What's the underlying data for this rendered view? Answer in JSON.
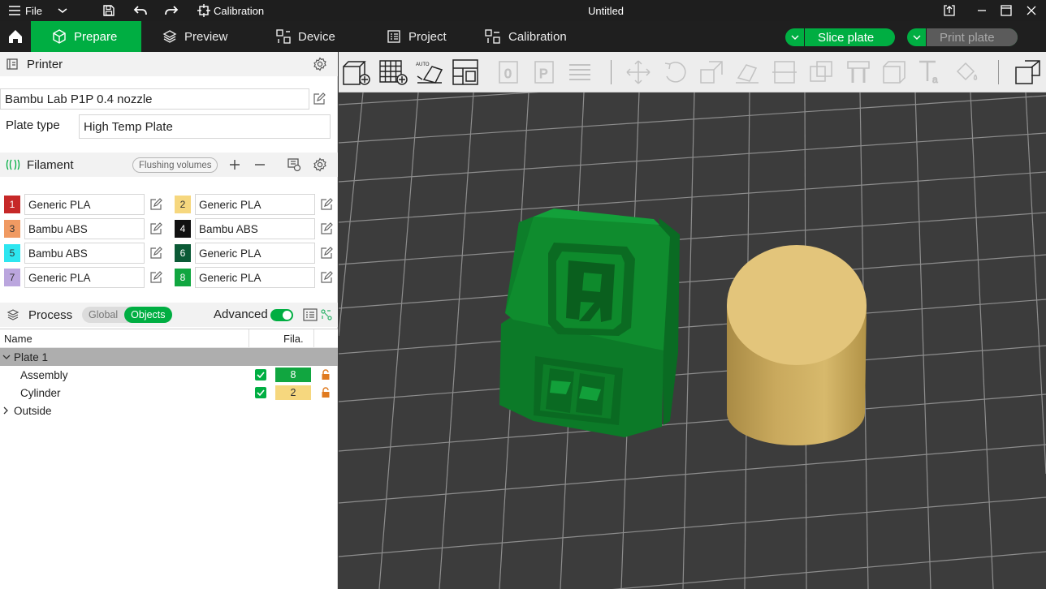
{
  "window": {
    "menu_label": "File",
    "calibration_label": "Calibration",
    "title": "Untitled"
  },
  "tabs": [
    {
      "label": "Prepare",
      "active": true
    },
    {
      "label": "Preview",
      "active": false
    },
    {
      "label": "Device",
      "active": false
    },
    {
      "label": "Project",
      "active": false
    },
    {
      "label": "Calibration",
      "active": false
    }
  ],
  "actions": {
    "slice_label": "Slice plate",
    "print_label": "Print plate"
  },
  "printer": {
    "section_title": "Printer",
    "preset": "Bambu Lab P1P 0.4 nozzle",
    "plate_type_label": "Plate type",
    "plate_type_value": "High Temp Plate"
  },
  "filament": {
    "section_title": "Filament",
    "flushing_label": "Flushing volumes",
    "items": [
      {
        "index": "1",
        "name": "Generic PLA",
        "color": "#c62828",
        "text_color": "#ffffff"
      },
      {
        "index": "2",
        "name": "Generic PLA",
        "color": "#f6d77e",
        "text_color": "#333333"
      },
      {
        "index": "3",
        "name": "Bambu ABS",
        "color": "#f09a62",
        "text_color": "#333333"
      },
      {
        "index": "4",
        "name": "Bambu ABS",
        "color": "#111111",
        "text_color": "#ffffff"
      },
      {
        "index": "5",
        "name": "Bambu ABS",
        "color": "#2ee6f0",
        "text_color": "#333333"
      },
      {
        "index": "6",
        "name": "Generic PLA",
        "color": "#0b5a36",
        "text_color": "#ffffff"
      },
      {
        "index": "7",
        "name": "Generic PLA",
        "color": "#bba6de",
        "text_color": "#333333"
      },
      {
        "index": "8",
        "name": "Generic PLA",
        "color": "#11a640",
        "text_color": "#ffffff"
      }
    ]
  },
  "process": {
    "section_title": "Process",
    "toggle_global": "Global",
    "toggle_objects": "Objects",
    "advanced_label": "Advanced"
  },
  "objects": {
    "col_name": "Name",
    "col_fila": "Fila.",
    "plate_label": "Plate 1",
    "rows": [
      {
        "name": "Assembly",
        "fila": "8",
        "fila_color": "#11a640",
        "fila_text": "#ffffff"
      },
      {
        "name": "Cylinder",
        "fila": "2",
        "fila_color": "#f6d77e",
        "fila_text": "#333333"
      }
    ],
    "outside_label": "Outside"
  },
  "colors": {
    "accent": "#00ae42",
    "title_bar": "#1e1e1e",
    "canvas_bg": "#3c3c3c",
    "cube_green": "#0d8a2c",
    "cylinder_tan": "#e3c57b"
  }
}
